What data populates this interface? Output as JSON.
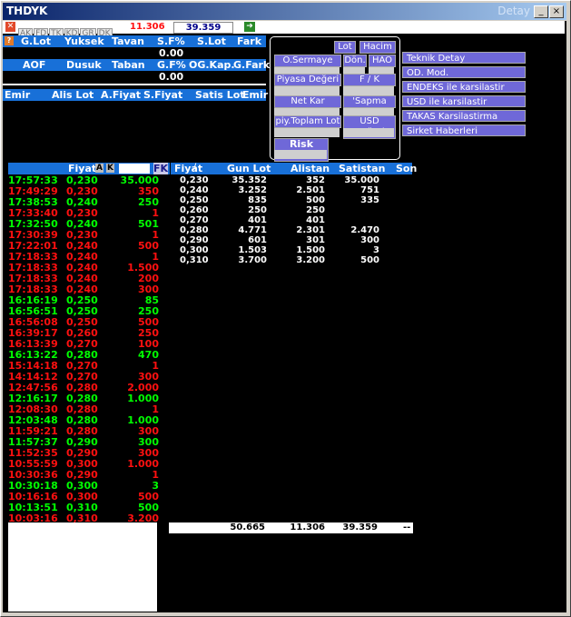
{
  "title": "THDYK",
  "title_right": "Detay",
  "toolbar": {
    "tabs": [
      "AK",
      "FD",
      "TK",
      "KD",
      "GR",
      "DK"
    ],
    "value1": "11.306",
    "value2": "39.359"
  },
  "header1": {
    "cols": [
      "G.Lot",
      "Yuksek",
      "Tavan",
      "S.F%",
      "S.Lot",
      "Fark"
    ]
  },
  "header1_values": {
    "sf_pct": "0.00"
  },
  "header2": {
    "cols": [
      "AOF",
      "Dusuk",
      "Taban",
      "G.F%",
      "OG.Kap.",
      "G.Fark"
    ]
  },
  "header2_values": {
    "gf_pct": "0.00"
  },
  "emir_header": {
    "cols": [
      "Emir",
      "Alis Lot",
      "A.Fiyat",
      "S.Fiyat",
      "Satis Lot",
      "Emir"
    ]
  },
  "popup": {
    "lot": "Lot",
    "hacim": "Hacim",
    "o_sermaye": "O.Sermaye",
    "don": "Dön.",
    "hao": "HAO",
    "piyasa_degeri": "Piyasa Değeri",
    "fk": "F / K",
    "net_kar": "Net Kar",
    "sapma": "'Sapma",
    "piy_toplam_lot": "piy.Toplam Lot",
    "usd_degeri": "USD Değeri",
    "risk_kodu": "Risk Kodu"
  },
  "right_menu": [
    "Teknik Detay",
    "OD. Mod.",
    "ENDEKS ile karsilastir",
    "USD ile karsilastir",
    "TAKAS Karsilastirma",
    "Sirket Haberleri"
  ],
  "trades_header": {
    "fiyat": "Fiyat",
    "a": "A",
    "k": "K",
    "fk": "FK"
  },
  "trades": [
    {
      "t": "17:57:33",
      "p": "0,230",
      "q": "35.000",
      "c": "g"
    },
    {
      "t": "17:49:29",
      "p": "0,230",
      "q": "350",
      "c": "r"
    },
    {
      "t": "17:38:53",
      "p": "0,240",
      "q": "250",
      "c": "g"
    },
    {
      "t": "17:33:40",
      "p": "0,230",
      "q": "1",
      "c": "r"
    },
    {
      "t": "17:32:50",
      "p": "0,240",
      "q": "501",
      "c": "g"
    },
    {
      "t": "17:30:39",
      "p": "0,230",
      "q": "1",
      "c": "r"
    },
    {
      "t": "17:22:01",
      "p": "0,240",
      "q": "500",
      "c": "r"
    },
    {
      "t": "17:18:33",
      "p": "0,240",
      "q": "1",
      "c": "r"
    },
    {
      "t": "17:18:33",
      "p": "0,240",
      "q": "1.500",
      "c": "r"
    },
    {
      "t": "17:18:33",
      "p": "0,240",
      "q": "200",
      "c": "r"
    },
    {
      "t": "17:18:33",
      "p": "0,240",
      "q": "300",
      "c": "r"
    },
    {
      "t": "16:16:19",
      "p": "0,250",
      "q": "85",
      "c": "g"
    },
    {
      "t": "16:56:51",
      "p": "0,250",
      "q": "250",
      "c": "g"
    },
    {
      "t": "16:56:08",
      "p": "0,250",
      "q": "500",
      "c": "r"
    },
    {
      "t": "16:39:17",
      "p": "0,260",
      "q": "250",
      "c": "r"
    },
    {
      "t": "16:13:39",
      "p": "0,270",
      "q": "100",
      "c": "r"
    },
    {
      "t": "16:13:22",
      "p": "0,280",
      "q": "470",
      "c": "g"
    },
    {
      "t": "15:14:18",
      "p": "0,270",
      "q": "1",
      "c": "r"
    },
    {
      "t": "14:14:12",
      "p": "0,270",
      "q": "300",
      "c": "r"
    },
    {
      "t": "12:47:56",
      "p": "0,280",
      "q": "2.000",
      "c": "r"
    },
    {
      "t": "12:16:17",
      "p": "0,280",
      "q": "1.000",
      "c": "g"
    },
    {
      "t": "12:08:30",
      "p": "0,280",
      "q": "1",
      "c": "r"
    },
    {
      "t": "12:03:48",
      "p": "0,280",
      "q": "1.000",
      "c": "g"
    },
    {
      "t": "11:59:21",
      "p": "0,280",
      "q": "300",
      "c": "r"
    },
    {
      "t": "11:57:37",
      "p": "0,290",
      "q": "300",
      "c": "g"
    },
    {
      "t": "11:52:35",
      "p": "0,290",
      "q": "300",
      "c": "r"
    },
    {
      "t": "10:55:59",
      "p": "0,300",
      "q": "1.000",
      "c": "r"
    },
    {
      "t": "10:30:36",
      "p": "0,290",
      "q": "1",
      "c": "r"
    },
    {
      "t": "10:30:18",
      "p": "0,300",
      "q": "3",
      "c": "g"
    },
    {
      "t": "10:16:16",
      "p": "0,300",
      "q": "500",
      "c": "r"
    },
    {
      "t": "10:13:51",
      "p": "0,310",
      "q": "500",
      "c": "g"
    },
    {
      "t": "10:03:16",
      "p": "0,310",
      "q": "3.200",
      "c": "r"
    }
  ],
  "depth_header": [
    "Fiyat",
    "Gun Lot",
    "Alistan",
    "Satistan",
    "Son"
  ],
  "depth_rows": [
    {
      "f": "0,230",
      "g": "35.352",
      "a": "352",
      "s": "35.000"
    },
    {
      "f": "0,240",
      "g": "3.252",
      "a": "2.501",
      "s": "751"
    },
    {
      "f": "0,250",
      "g": "835",
      "a": "500",
      "s": "335"
    },
    {
      "f": "0,260",
      "g": "250",
      "a": "250",
      "s": ""
    },
    {
      "f": "0,270",
      "g": "401",
      "a": "401",
      "s": ""
    },
    {
      "f": "0,280",
      "g": "4.771",
      "a": "2.301",
      "s": "2.470"
    },
    {
      "f": "0,290",
      "g": "601",
      "a": "301",
      "s": "300"
    },
    {
      "f": "0,300",
      "g": "1.503",
      "a": "1.500",
      "s": "3"
    },
    {
      "f": "0,310",
      "g": "3.700",
      "a": "3.200",
      "s": "500"
    }
  ],
  "depth_totals": {
    "gun": "50.665",
    "alis": "11.306",
    "satis": "39.359",
    "son": "--"
  },
  "colors": {
    "buy": "#00ff00",
    "sell": "#ff1010",
    "header": "#1870d8",
    "panel": "#6f68d8"
  }
}
